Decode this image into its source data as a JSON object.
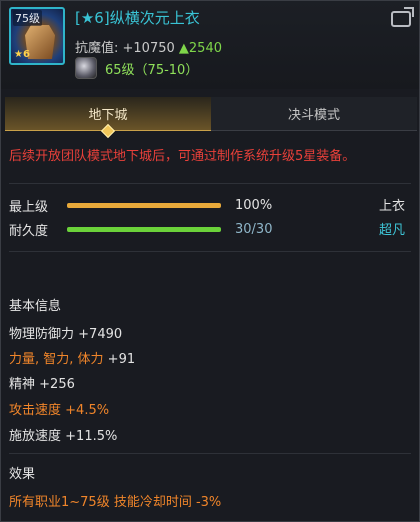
{
  "header": {
    "item_icon_level": "75级",
    "item_icon_star": "★6",
    "title": "[★6]纵横次元上衣",
    "power_label": "抗魔值: +10750",
    "power_up": "▲2540",
    "grade_text": "65级（75-10）"
  },
  "tabs": [
    {
      "label": "地下城",
      "active": true
    },
    {
      "label": "决斗模式",
      "active": false
    }
  ],
  "notice": "后续开放团队模式地下城后，可通过制作系统升级5星装备。",
  "bars": {
    "max_level": {
      "label": "最上级",
      "value_text": "100%",
      "fraction": 1.0,
      "color": "#e8a93a"
    },
    "durability": {
      "label": "耐久度",
      "value_text": "30/30",
      "fraction": 1.0,
      "color": "#6bd23a"
    }
  },
  "slot_type": "上衣",
  "rarity": "超凡",
  "basic_info": {
    "title": "基本信息",
    "stats": [
      {
        "name": "物理防御力",
        "value": "+7490",
        "highlight": false
      },
      {
        "name": "力量, 智力, 体力",
        "value": "+91",
        "highlight": true
      },
      {
        "name": "精神",
        "value": "+256",
        "highlight": false
      },
      {
        "name": "攻击速度",
        "value": "+4.5%",
        "highlight": true
      },
      {
        "name": "施放速度",
        "value": "+11.5%",
        "highlight": false
      }
    ]
  },
  "effects": {
    "title": "效果",
    "text": "所有职业1~75级 技能冷却时间 -3%"
  },
  "colors": {
    "title_cyan": "#39c3d4",
    "notice_red": "#e8403a",
    "highlight_orange": "#f0852a",
    "tab_gold": "#f1c75a"
  }
}
